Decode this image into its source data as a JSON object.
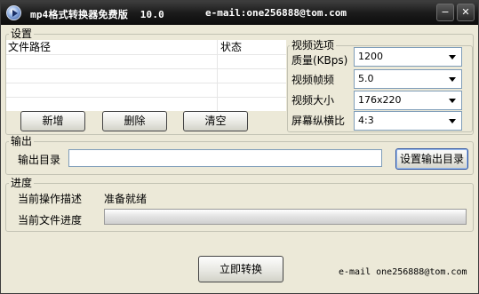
{
  "titlebar": {
    "title": "mp4格式转换器免费版  10.0",
    "email": "e-mail:one256888@tom.com",
    "minimize_symbol": "−",
    "close_symbol": "✕"
  },
  "settings": {
    "title": "设置",
    "columns": [
      "文件路径",
      "状态"
    ],
    "add_label": "新增",
    "delete_label": "删除",
    "clear_label": "清空"
  },
  "video_options": {
    "title": "视频选项",
    "quality": {
      "label": "质量(KBps)",
      "value": "1200"
    },
    "fps": {
      "label": "视频帧频",
      "value": "5.0"
    },
    "size": {
      "label": "视频大小",
      "value": "176x220"
    },
    "aspect": {
      "label": "屏幕纵横比",
      "value": "4:3"
    }
  },
  "output": {
    "title": "输出",
    "dir_label": "输出目录",
    "dir_value": "",
    "set_dir_label": "设置输出目录"
  },
  "progress": {
    "title": "进度",
    "op_label": "当前操作描述",
    "op_value": "准备就绪",
    "file_label": "当前文件进度",
    "file_progress": 0
  },
  "convert_label": "立即转换",
  "footer_email": "e-mail one256888@tom.com"
}
